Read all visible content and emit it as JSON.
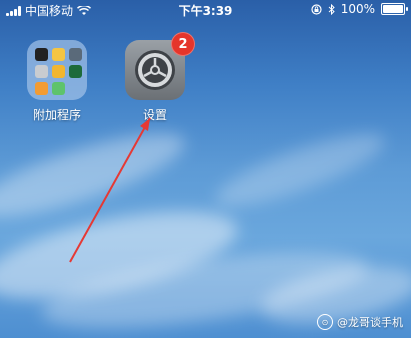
{
  "status_bar": {
    "carrier": "中国移动",
    "time": "下午3:39",
    "battery_percent": "100%",
    "battery_level": 1.0
  },
  "apps": {
    "folder": {
      "label": "附加程序"
    },
    "settings": {
      "label": "设置",
      "badge": "2"
    }
  },
  "watermark": {
    "text": "@龙哥谈手机"
  },
  "colors": {
    "badge": "#e5352b",
    "annotation_arrow": "#e53935"
  }
}
